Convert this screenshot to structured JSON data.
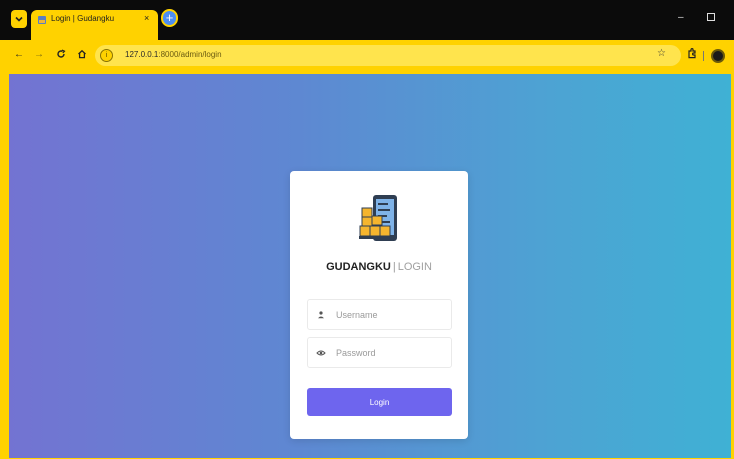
{
  "browser": {
    "tab": {
      "title": "Login | Gudangku",
      "close_glyph": "×"
    },
    "new_tab_glyph": "+",
    "address": {
      "host": "127.0.0.1",
      "path": ":8000/admin/login",
      "site_info_glyph": "i"
    },
    "window_controls": {
      "minimize_glyph": "–"
    },
    "icons": {
      "back": "arrow-left-icon",
      "forward": "arrow-right-icon",
      "reload": "reload-icon",
      "home": "home-icon",
      "bookmark": "star-icon",
      "extensions": "puzzle-icon",
      "profile": "avatar-icon"
    },
    "accent_color": "#ffd200"
  },
  "page": {
    "brand_main": "GUDANGKU",
    "brand_separator": "|",
    "brand_sub": "LOGIN",
    "username_placeholder": "Username",
    "password_placeholder": "Password",
    "login_label": "Login",
    "gradient_colors": [
      "#7373d2",
      "#3fb1d4"
    ],
    "button_color": "#6e65ee"
  }
}
